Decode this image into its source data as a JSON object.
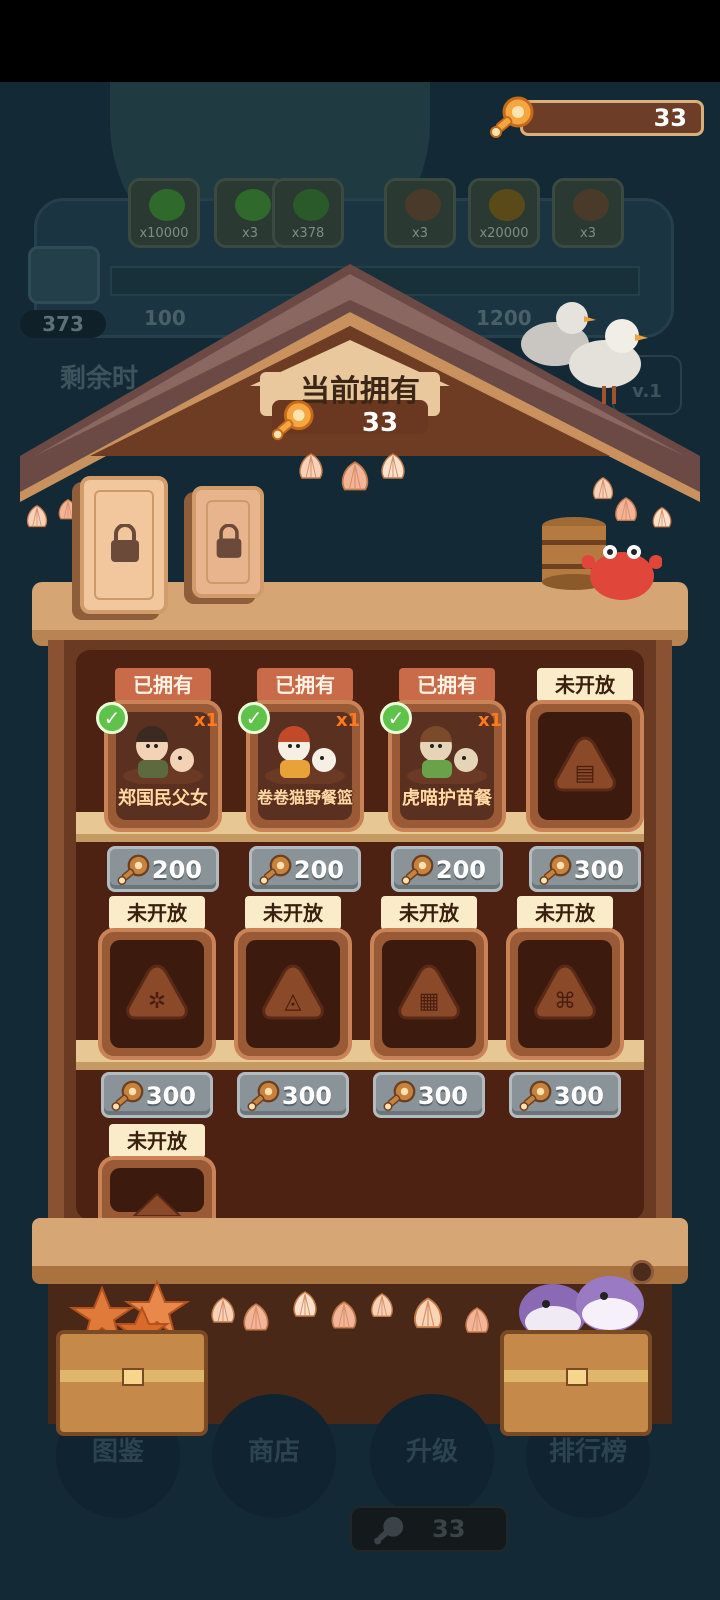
{
  "currency": {
    "value": "33"
  },
  "background": {
    "rewards": [
      {
        "label": "x10000",
        "icon": "green-check-icon",
        "color": "#2f6a2c"
      },
      {
        "label": "x3",
        "icon": "green-check-pile-icon",
        "color": "#2f6a2c"
      },
      {
        "label": "x378",
        "icon": "green-orb-icon",
        "color": "#2a5a2a"
      },
      {
        "label": "x3",
        "icon": "triangle-token-icon",
        "color": "#4a3a2a"
      },
      {
        "label": "x20000",
        "icon": "coin-icon",
        "color": "#5a4a1a"
      },
      {
        "label": "x3",
        "icon": "triangle-token-icon",
        "color": "#4a3a2a"
      }
    ],
    "track_labels": [
      "100",
      "1200"
    ],
    "score": "373",
    "remaining_label": "剩余时",
    "level_label": "v.1"
  },
  "house": {
    "title": "当前拥有",
    "count": "33"
  },
  "items": [
    {
      "tag": "已拥有",
      "owned": true,
      "qty": "x1",
      "name": "郑国民父女",
      "price": "200",
      "icon": "portrait-icon"
    },
    {
      "tag": "已拥有",
      "owned": true,
      "qty": "x1",
      "name": "卷卷猫野餐篮",
      "price": "200",
      "icon": "picnic-basket-icon"
    },
    {
      "tag": "已拥有",
      "owned": true,
      "qty": "x1",
      "name": "虎喵护苗餐",
      "price": "200",
      "icon": "meal-icon"
    },
    {
      "tag": "未开放",
      "owned": false,
      "price": "300",
      "icon": "locked-coin-token-icon"
    },
    {
      "tag": "未开放",
      "owned": false,
      "price": "300",
      "icon": "locked-phone-token-icon"
    },
    {
      "tag": "未开放",
      "owned": false,
      "price": "300",
      "icon": "locked-glyph-token-icon"
    },
    {
      "tag": "未开放",
      "owned": false,
      "price": "300",
      "icon": "locked-film-token-icon"
    },
    {
      "tag": "未开放",
      "owned": false,
      "price": "300",
      "icon": "locked-wheel-token-icon"
    },
    {
      "tag": "未开放",
      "owned": false,
      "icon": "locked-token-icon"
    }
  ],
  "nav": [
    {
      "label": "图鉴"
    },
    {
      "label": "商店"
    },
    {
      "label": "升级"
    },
    {
      "label": "排行榜"
    }
  ],
  "bottom_currency": {
    "value": "33"
  },
  "colors": {
    "accent_owned_tag": "#c96a48",
    "check_green": "#5fc24a",
    "qty_orange": "#ff7a1c"
  }
}
